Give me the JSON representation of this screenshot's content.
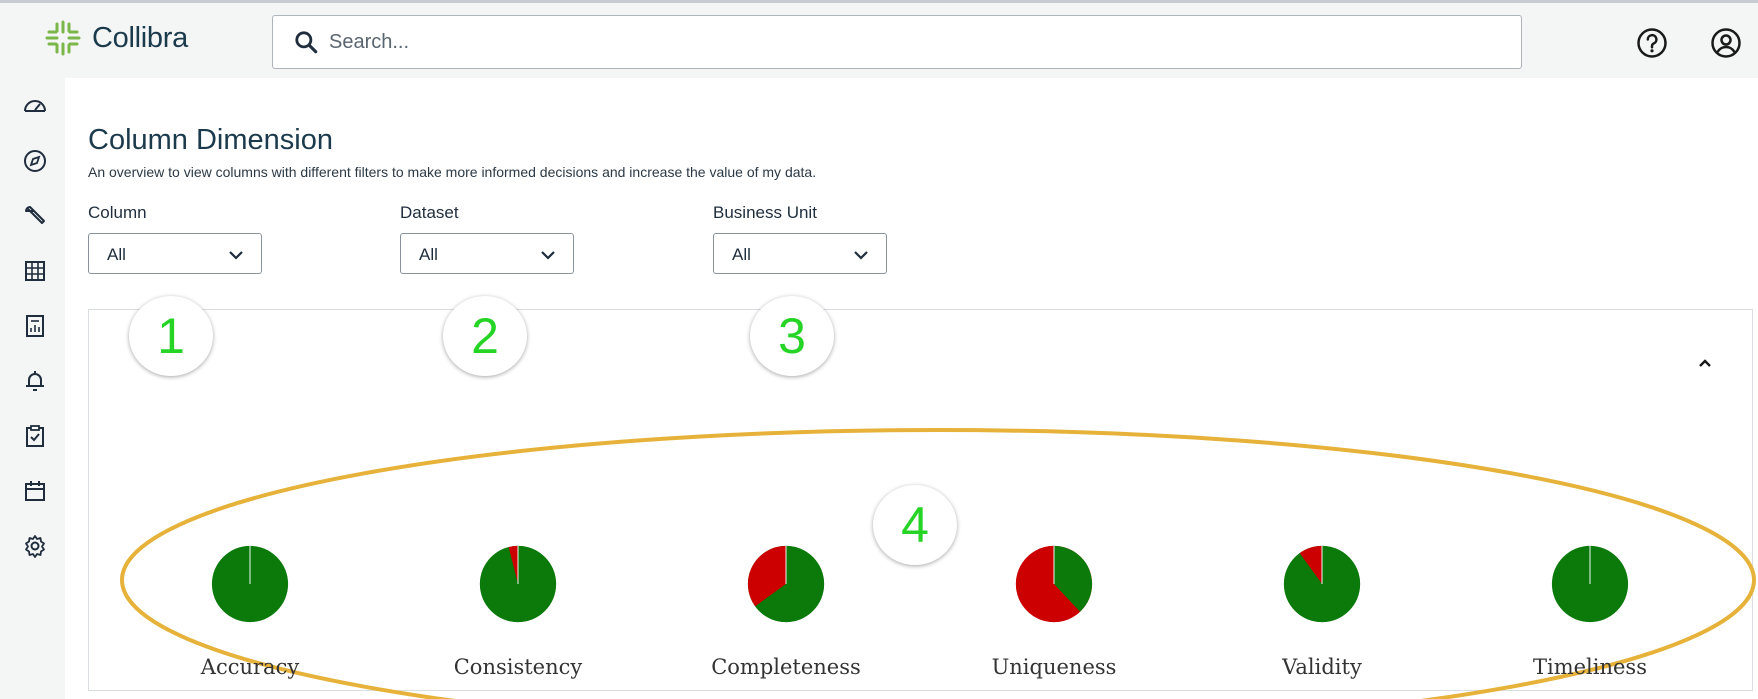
{
  "app": {
    "name": "Collibra"
  },
  "search": {
    "placeholder": "Search..."
  },
  "colors": {
    "good": "#0b7a0b",
    "bad": "#cc0000",
    "annotation": "#26d426",
    "highlight": "#e6b23a"
  },
  "sidebar": {
    "items": [
      "dashboard-icon",
      "compass-icon",
      "wrench-icon",
      "table-icon",
      "report-icon",
      "bell-icon",
      "clipboard-check-icon",
      "calendar-icon",
      "gear-icon"
    ]
  },
  "page": {
    "title": "Column Dimension",
    "subtitle": "An overview to view columns with different filters to make more informed decisions and increase the value of my data."
  },
  "filters": [
    {
      "label": "Column",
      "value": "All"
    },
    {
      "label": "Dataset",
      "value": "All"
    },
    {
      "label": "Business Unit",
      "value": "All"
    }
  ],
  "annotations": [
    "1",
    "2",
    "3",
    "4"
  ],
  "chart_data": {
    "type": "pie",
    "charts": [
      {
        "label": "Accuracy",
        "good": 1.0,
        "bad": 0.0
      },
      {
        "label": "Consistency",
        "good": 0.96,
        "bad": 0.04
      },
      {
        "label": "Completeness",
        "good": 0.65,
        "bad": 0.35
      },
      {
        "label": "Uniqueness",
        "good": 0.38,
        "bad": 0.62
      },
      {
        "label": "Validity",
        "good": 0.9,
        "bad": 0.1
      },
      {
        "label": "Timeliness",
        "good": 1.0,
        "bad": 0.0
      }
    ]
  }
}
